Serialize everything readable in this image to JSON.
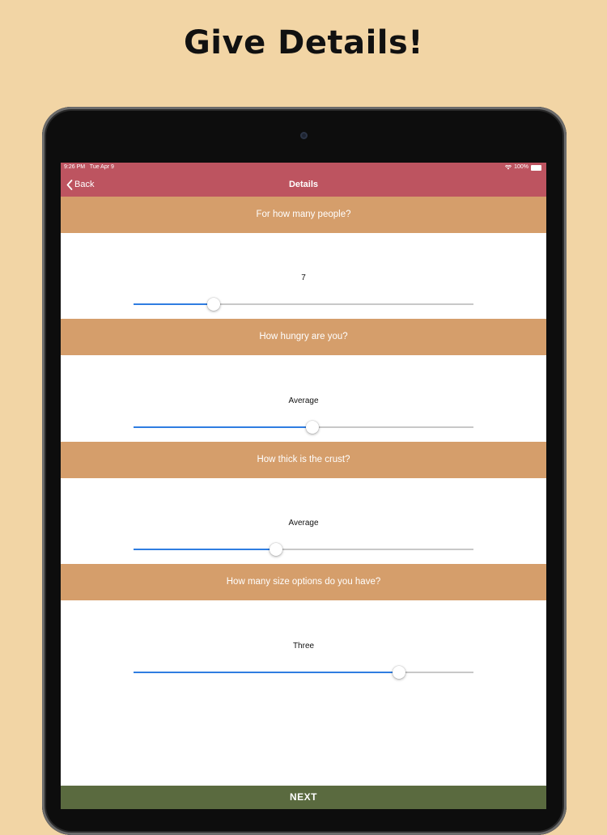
{
  "promo": {
    "title": "Give Details!"
  },
  "status_bar": {
    "time": "9:26 PM",
    "date": "Tue Apr 9",
    "battery": "100%"
  },
  "nav": {
    "back_label": "Back",
    "title": "Details"
  },
  "questions": [
    {
      "header": "For how many people?",
      "value_label": "7",
      "slider_value": 0.235
    },
    {
      "header": "How hungry are you?",
      "value_label": "Average",
      "slider_value": 0.525
    },
    {
      "header": "How thick is the crust?",
      "value_label": "Average",
      "slider_value": 0.42
    },
    {
      "header": "How many size options do you have?",
      "value_label": "Three",
      "slider_value": 0.78
    }
  ],
  "footer": {
    "next_label": "NEXT"
  },
  "colors": {
    "background": "#f2d5a5",
    "nav_bar": "#bd5460",
    "section_header": "#d59e6b",
    "slider_fill": "#2f7de1",
    "next_button": "#5a6a3f"
  }
}
